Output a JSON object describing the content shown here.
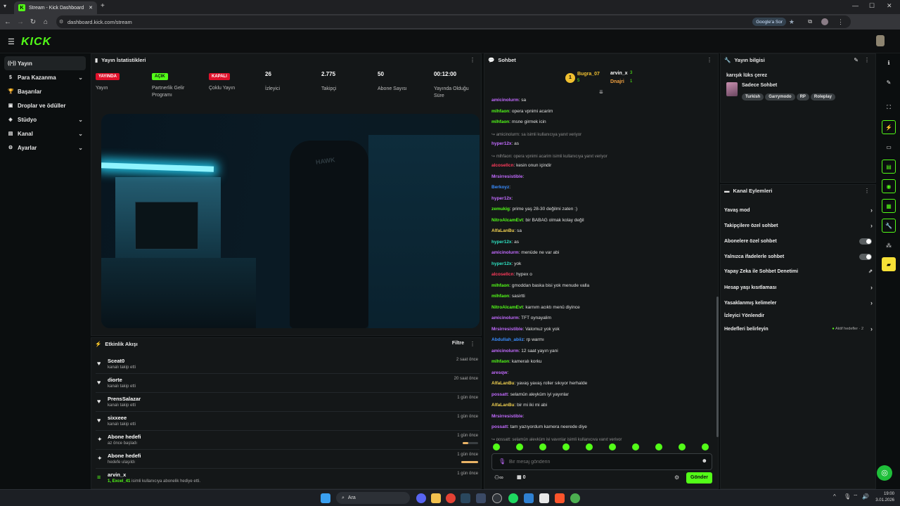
{
  "browser": {
    "tab_title": "Stream - Kick Dashboard",
    "url": "dashboard.kick.com/stream",
    "google_btn": "Google'a Sor"
  },
  "header": {
    "logo": "KICK"
  },
  "sidebar": {
    "items": [
      {
        "label": "Yayın",
        "icon": "broadcast-icon"
      },
      {
        "label": "Para Kazanma",
        "icon": "money-icon"
      },
      {
        "label": "Başarılar",
        "icon": "trophy-icon"
      },
      {
        "label": "Droplar ve ödüller",
        "icon": "gift-icon"
      },
      {
        "label": "Stüdyo",
        "icon": "studio-icon"
      },
      {
        "label": "Kanal",
        "icon": "channel-icon"
      },
      {
        "label": "Ayarlar",
        "icon": "gear-icon"
      }
    ]
  },
  "stats": {
    "title": "Yayın İstatistikleri",
    "items": [
      {
        "value": "YAYINDA",
        "label": "Yayın"
      },
      {
        "value": "AÇIK",
        "label": "Partnerlik Gelir Programı"
      },
      {
        "value": "KAPALI",
        "label": "Çoklu Yayın"
      },
      {
        "value": "26",
        "label": "İzleyici"
      },
      {
        "value": "2.775",
        "label": "Takipçi"
      },
      {
        "value": "50",
        "label": "Abone Sayısı"
      },
      {
        "value": "00:12:00",
        "label": "Yayında Olduğu Süre"
      }
    ]
  },
  "video": {
    "chair_text": "HAWK"
  },
  "events": {
    "title": "Etkinlik Akışı",
    "filter": "Filtre",
    "items": [
      {
        "name": "Sceat0",
        "sub": "kanalı takip etti",
        "time": "2 saat önce"
      },
      {
        "name": "diorte",
        "sub": "kanalı takip etti",
        "time": "20 saat önce"
      },
      {
        "name": "PrensSalazar",
        "sub": "kanalı takip etti",
        "time": "1 gün önce"
      },
      {
        "name": "sixxeee",
        "sub": "kanalı takip etti",
        "time": "1 gün önce"
      },
      {
        "name": "Abone hedefi",
        "sub": "az önce başladı",
        "time": "1 gün önce",
        "progress": 0.35
      },
      {
        "name": "Abone hedefi",
        "sub": "hedefe ulaşıldı",
        "time": "1 gün önce",
        "progress": 1.0
      },
      {
        "name": "arvin_x",
        "sub_user": "1, Excel_41",
        "sub": "isimli kullanıcıya abonelik hediye etti.",
        "time": "1 gün önce"
      }
    ]
  },
  "chat": {
    "title": "Sohbet",
    "leaders": [
      {
        "name": "Bugra_07",
        "count": "5"
      },
      {
        "name": "arvin_x",
        "count": "3"
      },
      {
        "name": "Dnajri",
        "count": "1"
      }
    ],
    "messages": [
      {
        "type": "msg",
        "user": "amicinolurm",
        "color": "#c36bff",
        "text": "sa"
      },
      {
        "type": "msg",
        "user": "mlhfaon",
        "color": "#53fc18",
        "text": "opera vpnimi acarim"
      },
      {
        "type": "msg",
        "user": "mlhfaon",
        "color": "#53fc18",
        "text": "msne girmek icin"
      },
      {
        "type": "reply",
        "text": "amicinolurm: sa isimli kullanıcıya yanıt veriyor"
      },
      {
        "type": "msg",
        "user": "hyper12x",
        "color": "#c36bff",
        "text": "as"
      },
      {
        "type": "reply",
        "text": "mlhfaon: opera vpnimi acarim isimli kullanıcıya yanıt veriyor"
      },
      {
        "type": "msg",
        "user": "alcosellcn",
        "color": "#ff3b5c",
        "text": "kesin onun içindir"
      },
      {
        "type": "msg",
        "user": "Mrsirresistible",
        "color": "#c36bff",
        "text": ""
      },
      {
        "type": "msg",
        "user": "Berkoyz",
        "color": "#3a8dff",
        "text": ""
      },
      {
        "type": "msg",
        "user": "hyper12x",
        "color": "#c36bff",
        "text": ""
      },
      {
        "type": "msg",
        "user": "zemukig",
        "color": "#53fc18",
        "text": "prime yaş 28-30 değilmi zaten :)"
      },
      {
        "type": "msg",
        "user": "NitroAlcamEvt",
        "color": "#53fc18",
        "text": "bir BABAG olmak kolay değil"
      },
      {
        "type": "msg",
        "user": "AlfaLanBu",
        "color": "#f0d050",
        "text": "sa"
      },
      {
        "type": "msg",
        "user": "hyper12x",
        "color": "#2ee0c0",
        "text": "as"
      },
      {
        "type": "msg",
        "user": "amicinolurm",
        "color": "#c36bff",
        "text": "menüde ne var abi"
      },
      {
        "type": "msg",
        "user": "hyper12x",
        "color": "#2ee0c0",
        "text": "yok"
      },
      {
        "type": "msg",
        "user": "alcosellcn",
        "color": "#ff3b5c",
        "text": "hypex o"
      },
      {
        "type": "msg",
        "user": "mlhfaon",
        "color": "#53fc18",
        "text": "gmoddan baska bisi yok menude valla"
      },
      {
        "type": "msg",
        "user": "mlhfaon",
        "color": "#53fc18",
        "text": "sasirtti"
      },
      {
        "type": "msg",
        "user": "NitroAlcamEvt",
        "color": "#53fc18",
        "text": "karnım acıktı menü diyince"
      },
      {
        "type": "msg",
        "user": "amicinolurm",
        "color": "#c36bff",
        "text": "TFT oynayalim"
      },
      {
        "type": "msg",
        "user": "Mrsirresistible",
        "color": "#c36bff",
        "text": "Valomuz yok yok"
      },
      {
        "type": "msg",
        "user": "Abdullah_abiiz",
        "color": "#3a8dff",
        "text": "rp warmı"
      },
      {
        "type": "msg",
        "user": "amicinolurm",
        "color": "#c36bff",
        "text": "12 saat yayın yani"
      },
      {
        "type": "msg",
        "user": "mlhfaon",
        "color": "#53fc18",
        "text": "kameralı korku"
      },
      {
        "type": "msg",
        "user": "aresqw",
        "color": "#c36bff",
        "text": ""
      },
      {
        "type": "msg",
        "user": "AlfaLanBu",
        "color": "#f0d050",
        "text": "yavaş yavaş roller sıkıyor herhalde"
      },
      {
        "type": "msg",
        "user": "possatt",
        "color": "#c36bff",
        "text": "selamün aleyküm iyi yayınlar"
      },
      {
        "type": "msg",
        "user": "AlfaLanBu",
        "color": "#f0d050",
        "text": "bir mi iki mi abi"
      },
      {
        "type": "msg",
        "user": "Mrsirresistible",
        "color": "#c36bff",
        "text": ""
      },
      {
        "type": "msg",
        "user": "possatt",
        "color": "#c36bff",
        "text": "tam yazıyordum kamera neerede diye"
      },
      {
        "type": "reply",
        "text": "possatt: selamün aleyküm iyi yayınlar isimli kullanıcıya yanıt veriyor"
      },
      {
        "type": "msg",
        "user": "AlfaLanBu",
        "color": "#f0d050",
        "text": "as"
      }
    ],
    "input_placeholder": "Bir mesaj gönderin",
    "points": "0",
    "send": "Gönder"
  },
  "info": {
    "title": "Yayın bilgisi",
    "stream_title": "karışık lüks çerez",
    "category": "Sadece Sohbet",
    "tags": [
      "Turkish",
      "Garrymodo",
      "RP",
      "Roleplay"
    ]
  },
  "actions": {
    "title": "Kanal Eylemleri",
    "items": [
      {
        "label": "Yavaş mod",
        "ctl": "arrow"
      },
      {
        "label": "Takipçilere özel sohbet",
        "ctl": "arrow"
      },
      {
        "label": "Abonelere özel sohbet",
        "ctl": "toggle"
      },
      {
        "label": "Yalnızca ifadelerle sohbet",
        "ctl": "toggle"
      },
      {
        "label": "Yapay Zeka ile Sohbet Denetimi",
        "ctl": "ext"
      },
      {
        "label": "Hesap yaşı kısıtlaması",
        "ctl": "arrow"
      },
      {
        "label": "Yasaklanmış kelimeler",
        "ctl": "arrow"
      },
      {
        "label": "İzleyici Yönlendir",
        "ctl": "none"
      },
      {
        "label": "Hedefleri belirleyin",
        "ctl": "arrow",
        "note": "Aktif hedefler · 2"
      }
    ]
  },
  "taskbar": {
    "search": "Ara",
    "time": "19:00",
    "date": "3.01.2026"
  },
  "colors": {
    "brand": "#53fc18",
    "live": "#e0112b",
    "panel": "#141718",
    "bg": "#0b0e0f"
  }
}
